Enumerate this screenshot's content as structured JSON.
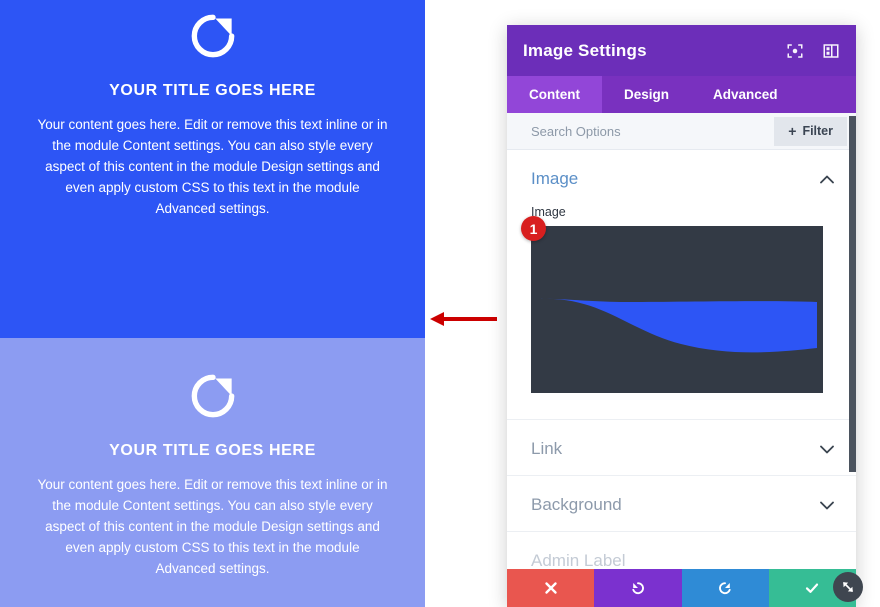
{
  "preview": {
    "panels": [
      {
        "icon": "refresh-icon",
        "title": "YOUR TITLE GOES HERE",
        "body": "Your content goes here. Edit or remove this text inline or in the module Content settings. You can also style every aspect of this content in the module Design settings and even apply custom CSS to this text in the module Advanced settings.",
        "background": "#2d55f5"
      },
      {
        "icon": "refresh-icon",
        "title": "YOUR TITLE GOES HERE",
        "body": "Your content goes here. Edit or remove this text inline or in the module Content settings. You can also style every aspect of this content in the module Design settings and even apply custom CSS to this text in the module Advanced settings.",
        "background": "#8c9cf2"
      }
    ],
    "annotation_arrow": "red-left-arrow"
  },
  "settings": {
    "header": {
      "title": "Image Settings",
      "icons": [
        "focus-target-icon",
        "layout-panel-icon"
      ],
      "background": "#6c2eb9"
    },
    "tabs": [
      {
        "label": "Content",
        "active": true
      },
      {
        "label": "Design",
        "active": false
      },
      {
        "label": "Advanced",
        "active": false
      }
    ],
    "search": {
      "placeholder": "Search Options",
      "value": "",
      "filter_label": "Filter",
      "filter_plus": "+"
    },
    "sections": [
      {
        "title": "Image",
        "state": "open",
        "field_label": "Image",
        "badge": "1",
        "thumbnail": {
          "background": "#333a45",
          "wave_color": "#2d55f5"
        }
      },
      {
        "title": "Link",
        "state": "closed"
      },
      {
        "title": "Background",
        "state": "closed"
      },
      {
        "title": "Admin Label",
        "state": "closed"
      }
    ],
    "actions": [
      {
        "name": "cancel",
        "icon": "close-x-icon",
        "color": "#e9564f"
      },
      {
        "name": "undo",
        "icon": "undo-arrow-icon",
        "color": "#7b31cf"
      },
      {
        "name": "redo",
        "icon": "redo-arrow-icon",
        "color": "#2f8bd6"
      },
      {
        "name": "save",
        "icon": "checkmark-icon",
        "color": "#36bd95"
      }
    ],
    "resize_handle_icon": "diagonal-resize-icon"
  }
}
